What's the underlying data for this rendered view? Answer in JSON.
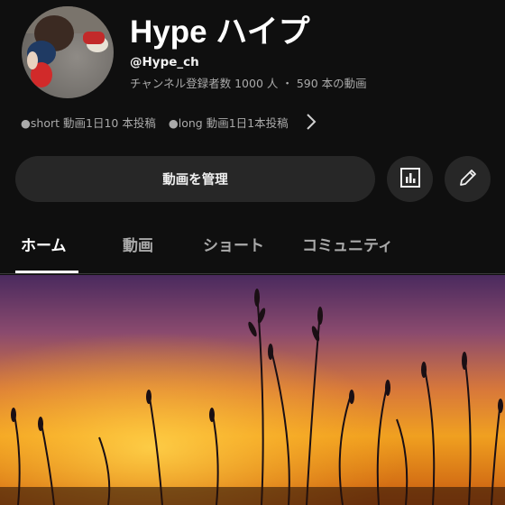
{
  "channel": {
    "name": "Hype ハイプ",
    "handle": "@Hype_ch",
    "stats": "チャンネル登録者数 1000 人 ・ 590 本の動画"
  },
  "description": {
    "items": [
      "●short 動画1日10 本投稿",
      "●long 動画1日1本投稿"
    ]
  },
  "actions": {
    "manage_label": "動画を管理",
    "analytics_icon": "analytics-icon",
    "edit_icon": "pencil-icon"
  },
  "tabs": [
    {
      "label": "ホーム",
      "active": true
    },
    {
      "label": "動画",
      "active": false
    },
    {
      "label": "ショート",
      "active": false
    },
    {
      "label": "コミュニティ",
      "active": false
    }
  ],
  "colors": {
    "background": "#0f0f0f",
    "button": "#272727",
    "secondary_text": "#aaaaaa"
  }
}
